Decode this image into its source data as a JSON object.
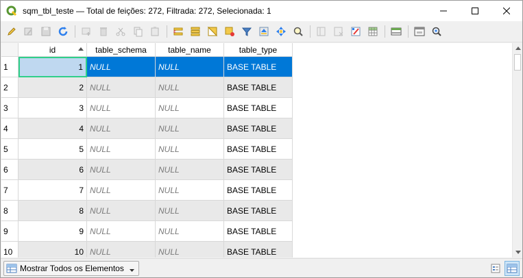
{
  "window": {
    "title": "sqm_tbl_teste — Total de feições: 272, Filtrada: 272, Selecionada: 1"
  },
  "colors": {
    "selection": "#0078d7",
    "alt_row": "#e9e9e9",
    "current_cell_border": "#2fcf8a"
  },
  "toolbar": {
    "icons": [
      "pencil-edit-icon",
      "multi-edit-icon",
      "save-edits-icon",
      "reload-icon",
      "add-feature-icon",
      "delete-feature-icon",
      "cut-icon",
      "copy-icon",
      "paste-icon",
      "select-expression-icon",
      "select-all-icon",
      "invert-selection-icon",
      "deselect-all-icon",
      "filter-select-icon",
      "move-selection-top-icon",
      "pan-to-selection-icon",
      "zoom-to-selection-icon",
      "new-field-icon",
      "delete-field-icon",
      "field-calculator-icon",
      "conditional-format-icon",
      "dock-table-icon",
      "actions-icon",
      "identify-icon"
    ]
  },
  "table": {
    "columns": [
      {
        "label": "id",
        "sorted": "asc"
      },
      {
        "label": "table_schema"
      },
      {
        "label": "table_name"
      },
      {
        "label": "table_type"
      }
    ],
    "rows": [
      {
        "num": "1",
        "id": "1",
        "schema": "NULL",
        "name": "NULL",
        "type": "BASE TABLE",
        "selected": true
      },
      {
        "num": "2",
        "id": "2",
        "schema": "NULL",
        "name": "NULL",
        "type": "BASE TABLE"
      },
      {
        "num": "3",
        "id": "3",
        "schema": "NULL",
        "name": "NULL",
        "type": "BASE TABLE"
      },
      {
        "num": "4",
        "id": "4",
        "schema": "NULL",
        "name": "NULL",
        "type": "BASE TABLE"
      },
      {
        "num": "5",
        "id": "5",
        "schema": "NULL",
        "name": "NULL",
        "type": "BASE TABLE"
      },
      {
        "num": "6",
        "id": "6",
        "schema": "NULL",
        "name": "NULL",
        "type": "BASE TABLE"
      },
      {
        "num": "7",
        "id": "7",
        "schema": "NULL",
        "name": "NULL",
        "type": "BASE TABLE"
      },
      {
        "num": "8",
        "id": "8",
        "schema": "NULL",
        "name": "NULL",
        "type": "BASE TABLE"
      },
      {
        "num": "9",
        "id": "9",
        "schema": "NULL",
        "name": "NULL",
        "type": "BASE TABLE"
      },
      {
        "num": "10",
        "id": "10",
        "schema": "NULL",
        "name": "NULL",
        "type": "BASE TABLE"
      }
    ]
  },
  "statusbar": {
    "filter_label": "Mostrar Todos os Elementos"
  }
}
